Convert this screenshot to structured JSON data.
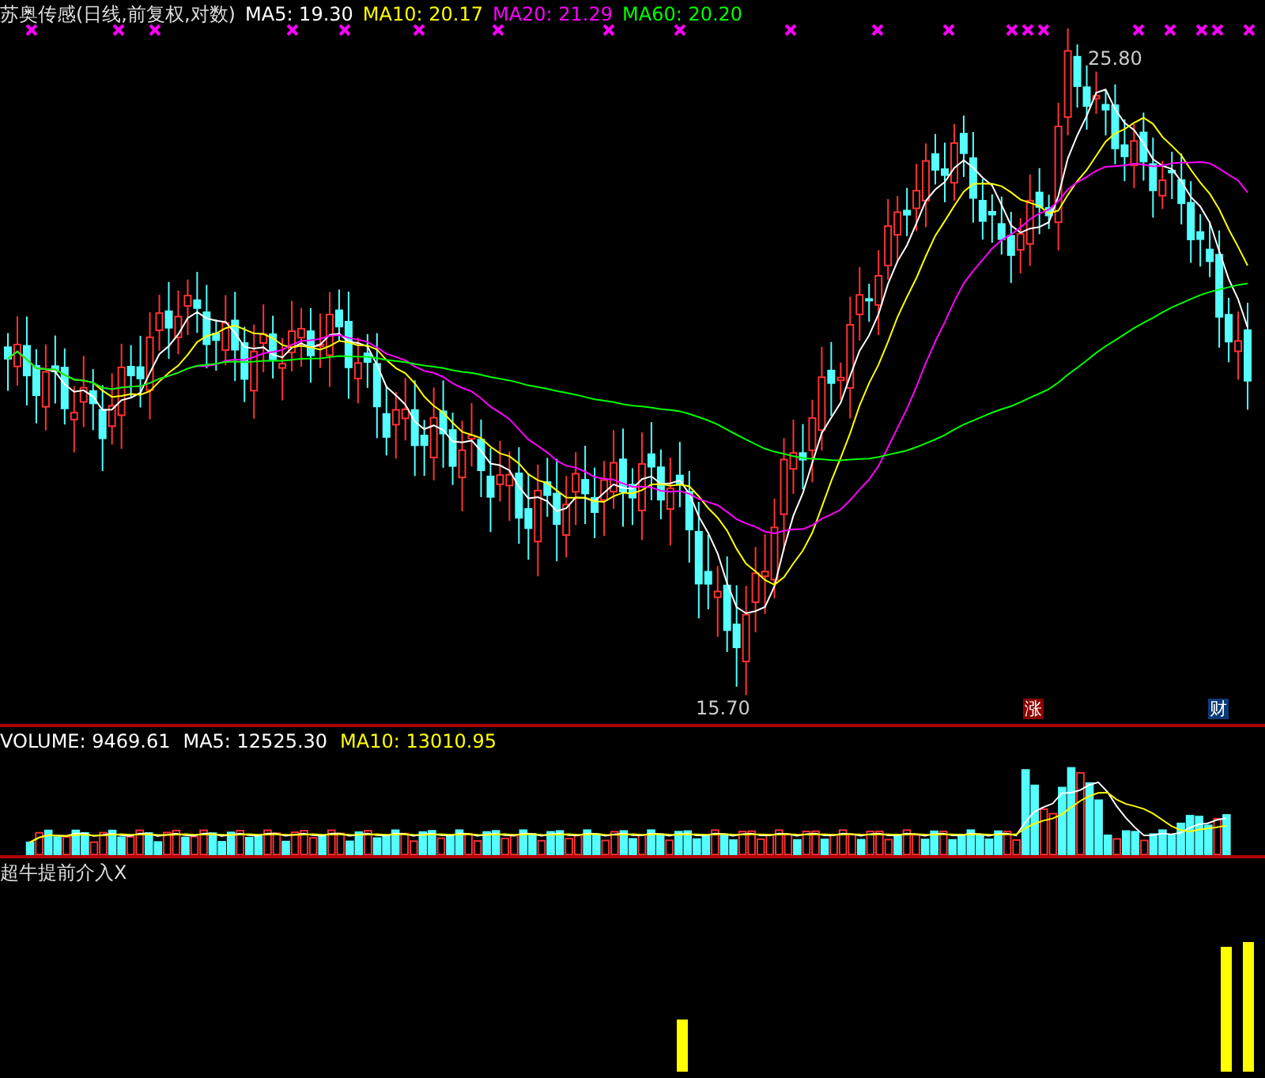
{
  "main_chart": {
    "title": "苏奥传感(日线,前复权,对数)",
    "legend": [
      {
        "label": "MA5: 19.30",
        "color": "#ffffff"
      },
      {
        "label": "MA10: 20.17",
        "color": "#ffff00"
      },
      {
        "label": "MA20: 21.29",
        "color": "#ff00ff"
      },
      {
        "label": "MA60: 20.20",
        "color": "#00ff00"
      }
    ],
    "high_label": "25.80",
    "low_label": "15.70",
    "events": [
      {
        "label": "涨",
        "color": "#8b0000"
      },
      {
        "label": "财",
        "color": "#0b3a78"
      }
    ]
  },
  "volume_chart": {
    "legend": [
      {
        "label": "VOLUME: 9469.61",
        "color": "#ffffff"
      },
      {
        "label": "MA5: 12525.30",
        "color": "#ffffff"
      },
      {
        "label": "MA10: 13010.95",
        "color": "#ffff00"
      }
    ]
  },
  "indicator_chart": {
    "title": "超牛提前介入X"
  }
}
